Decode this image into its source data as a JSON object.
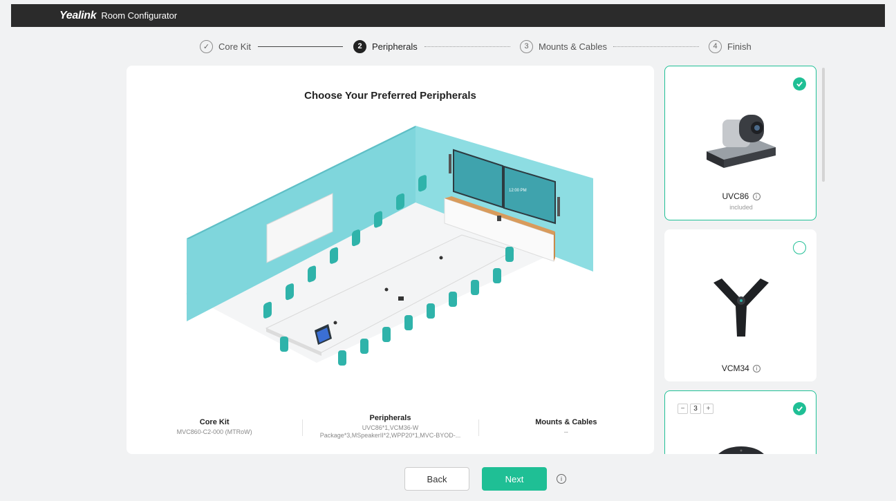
{
  "header": {
    "brand": "Yealink",
    "title": "Room Configurator"
  },
  "steps": [
    {
      "marker": "✓",
      "label": "Core Kit",
      "state": "done"
    },
    {
      "marker": "2",
      "label": "Peripherals",
      "state": "active"
    },
    {
      "marker": "3",
      "label": "Mounts & Cables",
      "state": "upcoming"
    },
    {
      "marker": "4",
      "label": "Finish",
      "state": "upcoming"
    }
  ],
  "main": {
    "title": "Choose Your Preferred Peripherals",
    "screen_time": "12:00 PM",
    "summary": {
      "core_kit": {
        "label": "Core Kit",
        "value": "MVC860-C2-000 (MTRoW)"
      },
      "peripherals": {
        "label": "Peripherals",
        "line1": "UVC86*1,VCM36-W",
        "line2": "Package*3,MSpeakerII*2,WPP20*1,MVC-BYOD-..."
      },
      "mounts": {
        "label": "Mounts & Cables",
        "value": "--"
      }
    }
  },
  "products": [
    {
      "name": "UVC86",
      "info": "i",
      "subtitle": "included",
      "selected": true
    },
    {
      "name": "VCM34",
      "info": "i",
      "selected": false
    },
    {
      "quantity": "3",
      "minus": "−",
      "plus": "+",
      "selected": true
    }
  ],
  "footer": {
    "back": "Back",
    "next": "Next",
    "info": "i"
  },
  "colors": {
    "accent": "#1fbf95",
    "wall": "#7fd6dc",
    "header": "#2b2b2b"
  }
}
